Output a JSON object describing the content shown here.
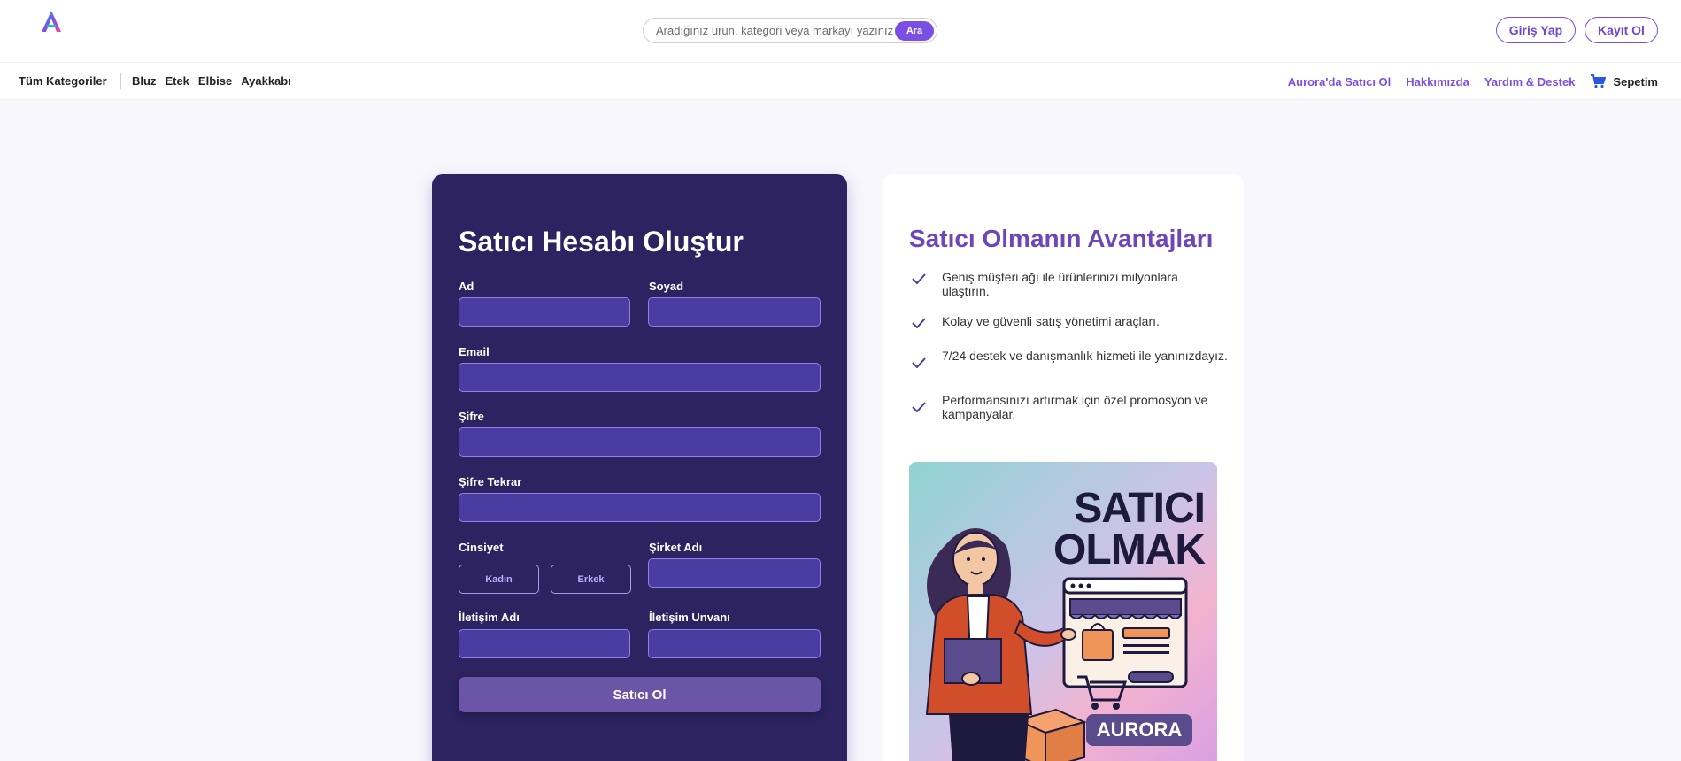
{
  "header": {
    "search": {
      "placeholder": "Aradığınız ürün, kategori veya markayı yazınız",
      "button_label": "Ara"
    },
    "login_label": "Giriş Yap",
    "register_label": "Kayıt Ol",
    "logo_icon": "aurora-logo-icon"
  },
  "nav": {
    "all_categories": "Tüm Kategoriler",
    "categories": [
      "Bluz",
      "Etek",
      "Elbise",
      "Ayakkabı"
    ],
    "links": [
      "Aurora'da Satıcı Ol",
      "Hakkımızda",
      "Yardım & Destek"
    ],
    "cart_label": "Sepetim",
    "cart_icon": "cart-icon"
  },
  "form": {
    "title": "Satıcı Hesabı Oluştur",
    "first_name_label": "Ad",
    "last_name_label": "Soyad",
    "email_label": "Email",
    "password_label": "Şifre",
    "password_repeat_label": "Şifre Tekrar",
    "gender_label": "Cinsiyet",
    "gender_options": [
      "Kadın",
      "Erkek"
    ],
    "company_label": "Şirket Adı",
    "contact_name_label": "İletişim Adı",
    "contact_title_label": "İletişim Unvanı",
    "submit_label": "Satıcı Ol"
  },
  "advantages": {
    "title": "Satıcı Olmanın Avantajları",
    "items": [
      "Geniş müşteri ağı ile ürünlerinizi milyonlara ulaştırın.",
      "Kolay ve güvenli satış yönetimi araçları.",
      "7/24 destek ve danışmanlık hizmeti ile yanınızdayız.",
      "Performansınızı artırmak için özel promosyon ve kampanyalar."
    ],
    "promo": {
      "line1": "SATICI",
      "line2": "OLMAK",
      "badge": "AURORA"
    }
  },
  "colors": {
    "accent": "#7b4fe6",
    "form_bg": "#2c2360",
    "field_bg": "#4a3ca0",
    "title_purple": "#6d46b8"
  }
}
